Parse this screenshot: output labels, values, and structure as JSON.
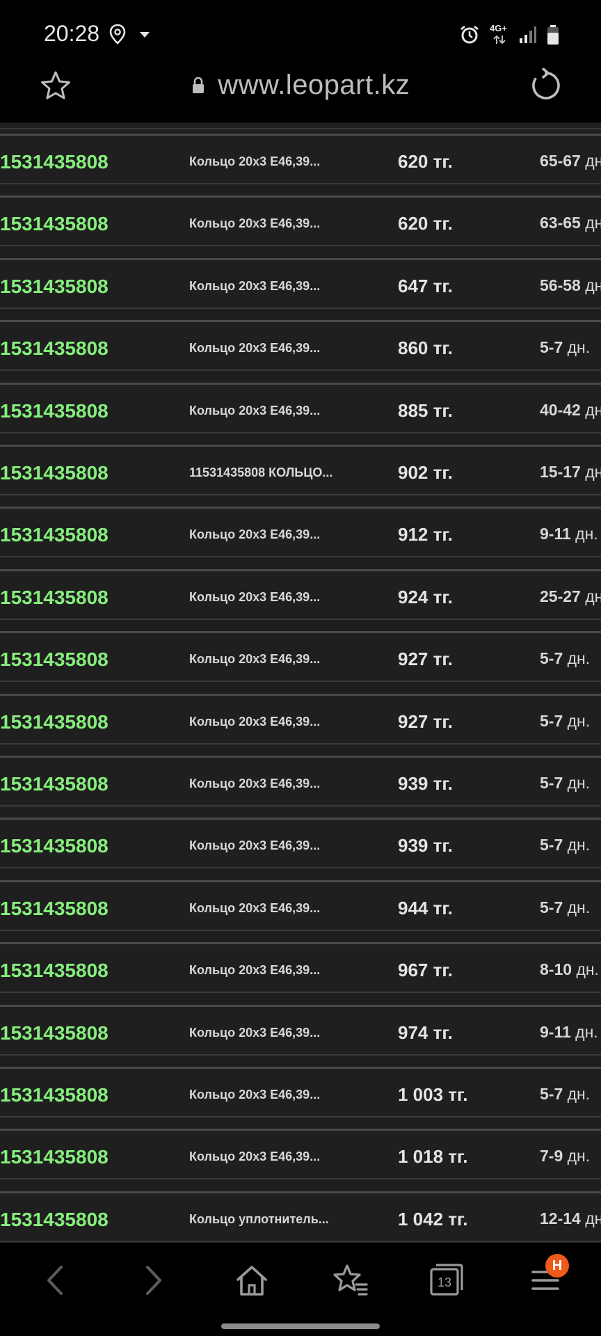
{
  "status": {
    "time": "20:28",
    "network": "4G+"
  },
  "browser": {
    "url": "www.leopart.kz",
    "tab_count": "13",
    "menu_badge": "H"
  },
  "rows": [
    {
      "code": "1531435808",
      "name": "Кольцо 20x3 E46,39...",
      "price": "620 тг.",
      "term": "65-67",
      "unit": "дн"
    },
    {
      "code": "1531435808",
      "name": "Кольцо 20x3 E46,39...",
      "price": "620 тг.",
      "term": "63-65",
      "unit": "дн"
    },
    {
      "code": "1531435808",
      "name": "Кольцо 20x3 E46,39...",
      "price": "647 тг.",
      "term": "56-58",
      "unit": "дн"
    },
    {
      "code": "1531435808",
      "name": "Кольцо 20x3 E46,39...",
      "price": "860 тг.",
      "term": "5-7",
      "unit": "дн."
    },
    {
      "code": "1531435808",
      "name": "Кольцо 20x3 E46,39...",
      "price": "885 тг.",
      "term": "40-42",
      "unit": "дн"
    },
    {
      "code": "1531435808",
      "name": "11531435808 КОЛЬЦО...",
      "price": "902 тг.",
      "term": "15-17",
      "unit": "дн"
    },
    {
      "code": "1531435808",
      "name": "Кольцо 20x3 E46,39...",
      "price": "912 тг.",
      "term": "9-11",
      "unit": "дн."
    },
    {
      "code": "1531435808",
      "name": "Кольцо 20x3 E46,39...",
      "price": "924 тг.",
      "term": "25-27",
      "unit": "дн"
    },
    {
      "code": "1531435808",
      "name": "Кольцо 20x3 E46,39...",
      "price": "927 тг.",
      "term": "5-7",
      "unit": "дн."
    },
    {
      "code": "1531435808",
      "name": "Кольцо 20x3 E46,39...",
      "price": "927 тг.",
      "term": "5-7",
      "unit": "дн."
    },
    {
      "code": "1531435808",
      "name": "Кольцо 20x3 E46,39...",
      "price": "939 тг.",
      "term": "5-7",
      "unit": "дн."
    },
    {
      "code": "1531435808",
      "name": "Кольцо 20x3 E46,39...",
      "price": "939 тг.",
      "term": "5-7",
      "unit": "дн."
    },
    {
      "code": "1531435808",
      "name": "Кольцо 20x3 E46,39...",
      "price": "944 тг.",
      "term": "5-7",
      "unit": "дн."
    },
    {
      "code": "1531435808",
      "name": "Кольцо 20x3 E46,39...",
      "price": "967 тг.",
      "term": "8-10",
      "unit": "дн."
    },
    {
      "code": "1531435808",
      "name": "Кольцо 20x3 E46,39...",
      "price": "974 тг.",
      "term": "9-11",
      "unit": "дн."
    },
    {
      "code": "1531435808",
      "name": "Кольцо 20x3 E46,39...",
      "price": "1 003 тг.",
      "term": "5-7",
      "unit": "дн."
    },
    {
      "code": "1531435808",
      "name": "Кольцо 20x3 E46,39...",
      "price": "1 018 тг.",
      "term": "7-9",
      "unit": "дн."
    },
    {
      "code": "1531435808",
      "name": "Кольцо уплотнитель...",
      "price": "1 042 тг.",
      "term": "12-14",
      "unit": "дн"
    }
  ]
}
